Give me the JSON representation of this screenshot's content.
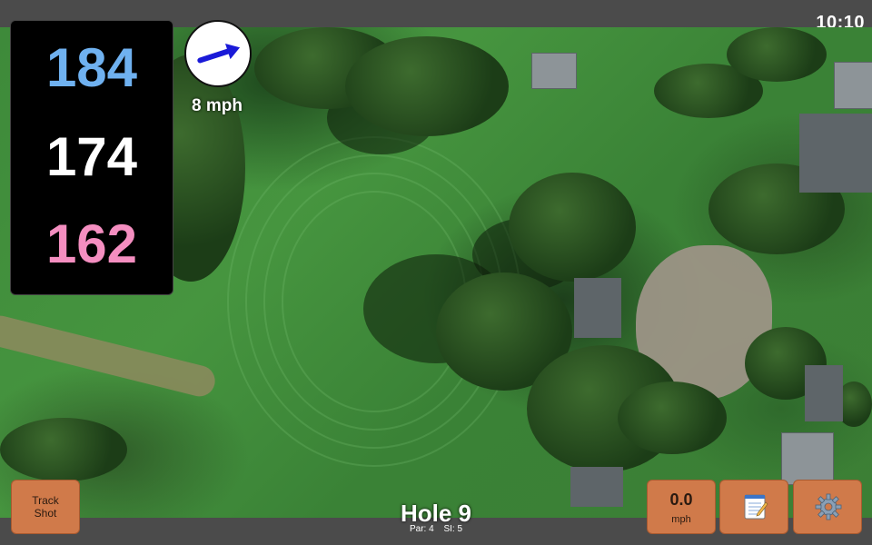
{
  "clock": {
    "time": "10:10"
  },
  "distances": {
    "back": "184",
    "middle": "174",
    "front": "162"
  },
  "wind": {
    "speed_label": "8 mph",
    "arrow_icon": "wind-arrow-icon"
  },
  "hole": {
    "title": "Hole 9",
    "par": "Par: 4",
    "si": "SI: 5"
  },
  "buttons": {
    "track_shot": [
      "Track",
      "Shot"
    ],
    "speed_value": "0.0",
    "speed_unit": "mph",
    "notes_icon": "notepad-icon",
    "settings_icon": "gear-icon"
  },
  "colors": {
    "back": "#6fb1f0",
    "middle": "#ffffff",
    "front": "#f48ec0",
    "button": "#d07a4a"
  }
}
